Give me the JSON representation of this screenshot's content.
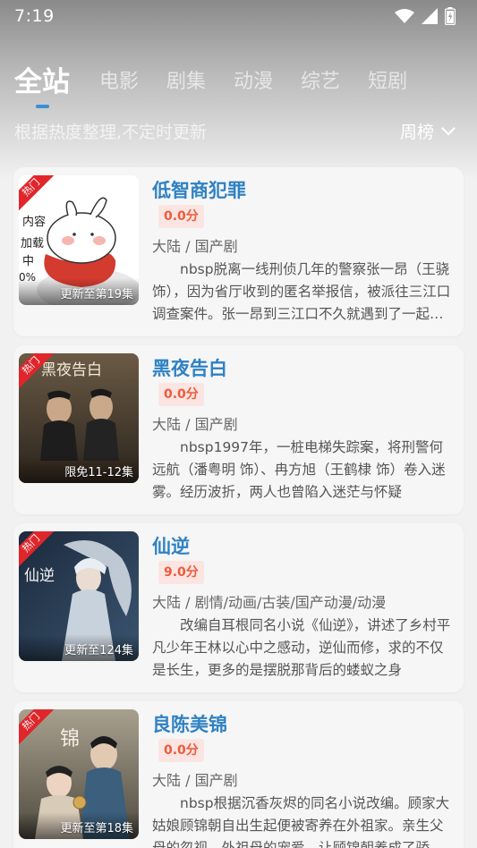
{
  "status": {
    "time": "7:19"
  },
  "tabs": [
    {
      "label": "全站",
      "active": true
    },
    {
      "label": "电影"
    },
    {
      "label": "剧集"
    },
    {
      "label": "动漫"
    },
    {
      "label": "综艺"
    },
    {
      "label": "短剧"
    }
  ],
  "subtitle": "根据热度整理,不定时更新",
  "rank_select": {
    "label": "周榜"
  },
  "colors": {
    "accent": "#2f82c3",
    "indicator": "#3a8fd6",
    "score_text": "#ef5a3b",
    "badge": "#e0262b"
  },
  "items": [
    {
      "badge": "热门",
      "poster_text": "更新至第19集",
      "poster_art_text": [
        "内容",
        "加载",
        "中",
        "0%"
      ],
      "title": "低智商犯罪",
      "score": "0.0分",
      "meta": "大陆 / 国产剧",
      "desc": "nbsp脱离一线刑侦几年的警察张一昂（王骁 饰），因为省厅收到的匿名举报信，被派往三江口调查案件。张一昂到三江口不久就遇到了一起离奇的绑架案"
    },
    {
      "badge": "热门",
      "poster_text": "限免11-12集",
      "poster_art_text": [
        "黑夜告白"
      ],
      "title": "黑夜告白",
      "score": "0.0分",
      "meta": "大陆 / 国产剧",
      "desc": "nbsp1997年，一桩电梯失踪案，将刑警何远航（潘粤明 饰）、冉方旭（王鹤棣 饰）卷入迷雾。经历波折，两人也曾陷入迷茫与怀疑"
    },
    {
      "badge": "热门",
      "poster_text": "更新至124集",
      "poster_art_text": [
        "仙逆"
      ],
      "title": "仙逆",
      "score": "9.0分",
      "meta": "大陆 / 剧情/动画/古装/国产动漫/动漫",
      "desc": "改编自耳根同名小说《仙逆》，讲述了乡村平凡少年王林以心中之感动，逆仙而修，求的不仅是长生，更多的是摆脱那背后的蝼蚁之身"
    },
    {
      "badge": "热门",
      "poster_text": "更新至第18集",
      "poster_art_text": [
        "锦"
      ],
      "title": "良陈美锦",
      "score": "0.0分",
      "meta": "大陆 / 国产剧",
      "desc": "nbsp根据沉香灰烬的同名小说改编。顾家大姑娘顾锦朝自出生起便被寄养在外祖家。亲生父母的忽视，外祖母的宠爱，让顾锦朝养成了骄纵的性子"
    }
  ]
}
